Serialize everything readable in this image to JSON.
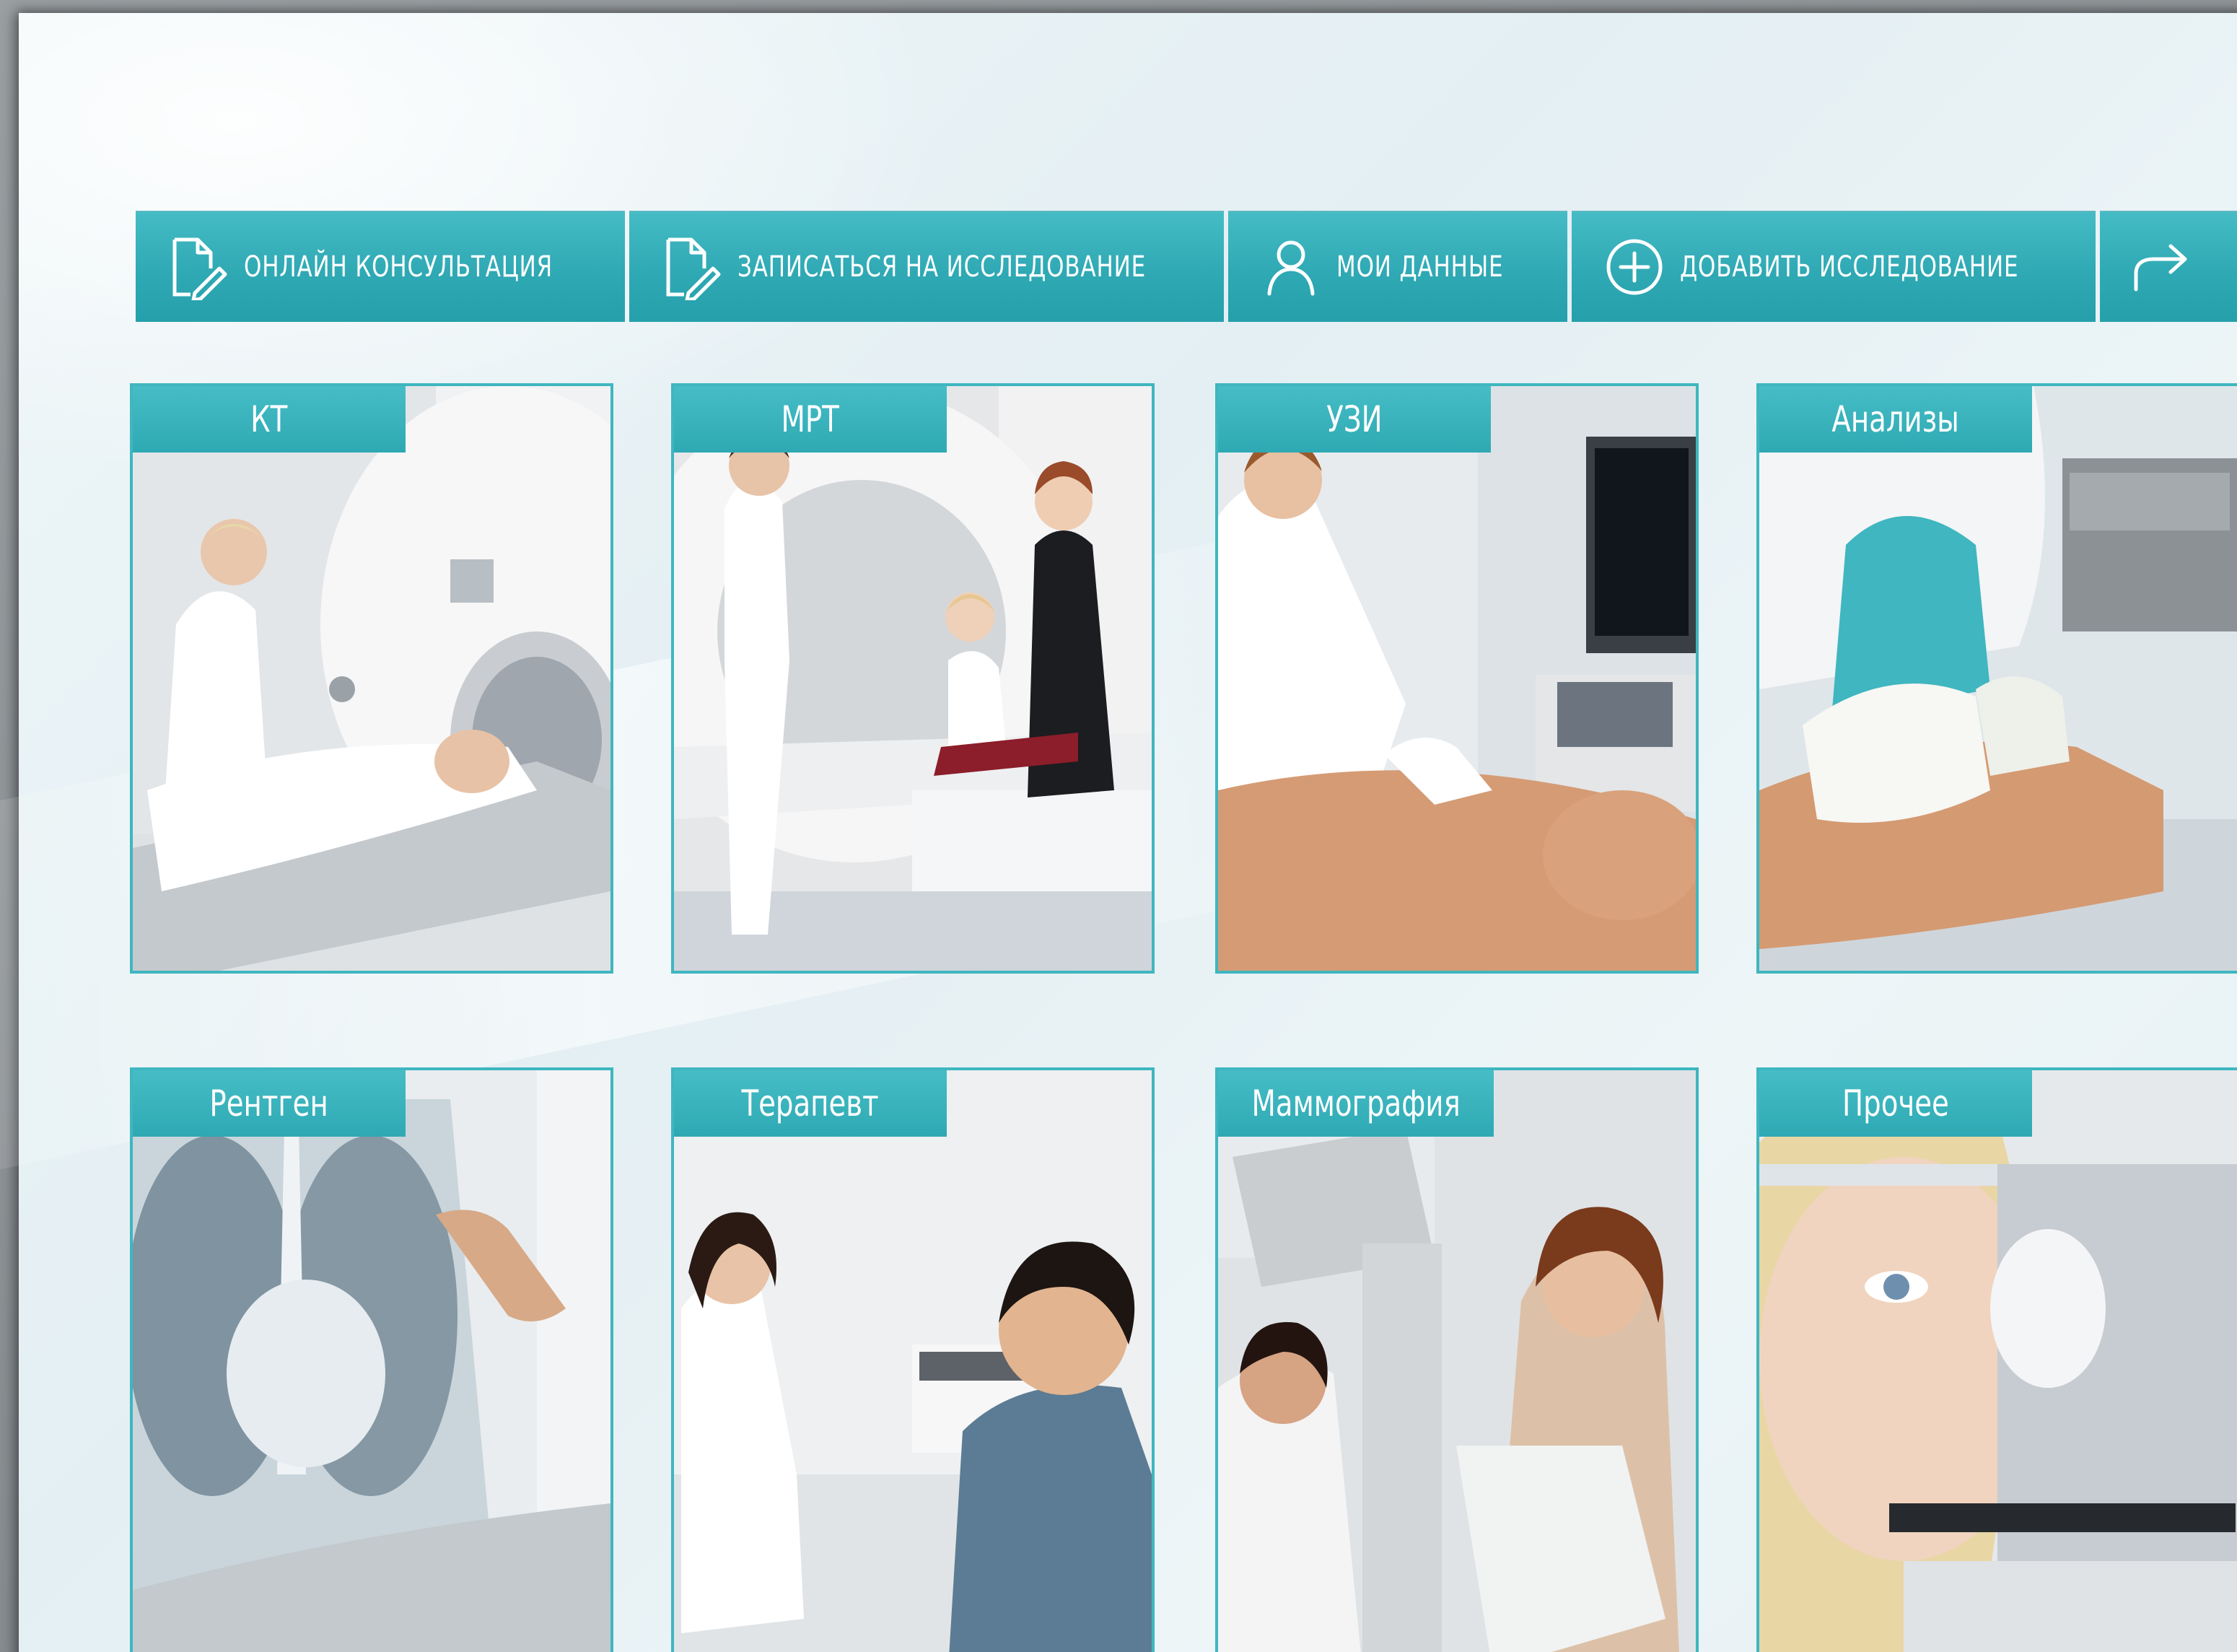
{
  "nav": {
    "items": [
      {
        "label": "ОНЛАЙН КОНСУЛЬТАЦИЯ",
        "icon": "document-pen-icon"
      },
      {
        "label": "ЗАПИСАТЬСЯ НА ИССЛЕДОВАНИЕ",
        "icon": "document-pen-icon"
      },
      {
        "label": "МОИ ДАННЫЕ",
        "icon": "user-icon"
      },
      {
        "label": "ДОБАВИТЬ ИССЛЕДОВАНИЕ",
        "icon": "plus-circle-icon"
      },
      {
        "label": "",
        "icon": "share-arrow-icon"
      }
    ]
  },
  "tiles": [
    {
      "label": "КТ"
    },
    {
      "label": "МРТ"
    },
    {
      "label": "УЗИ"
    },
    {
      "label": "Анализы"
    },
    {
      "label": "Рентген"
    },
    {
      "label": "Терапевт"
    },
    {
      "label": "Маммография"
    },
    {
      "label": "Прочее"
    }
  ],
  "colors": {
    "accent": "#2fa9b4",
    "accent_light": "#46bdc6",
    "background": "#eaf3f6",
    "text_on_accent": "#ffffff"
  }
}
